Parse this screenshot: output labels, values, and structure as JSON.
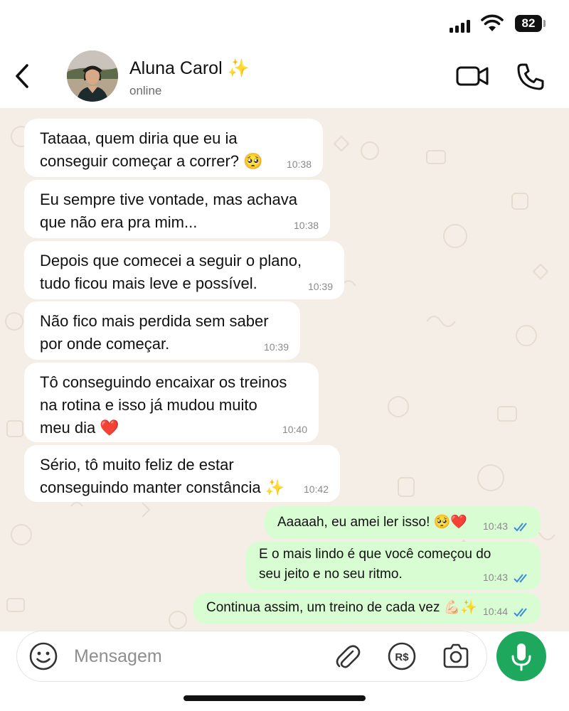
{
  "status_bar": {
    "battery": "82"
  },
  "header": {
    "name": "Aluna Carol ✨",
    "status": "online"
  },
  "messages": [
    {
      "direction": "in",
      "text": "Tataaa, quem diria que eu ia\nconseguir começar a correr? 🥺",
      "time": "10:38"
    },
    {
      "direction": "in",
      "text": "Eu sempre tive vontade, mas achava\nque não era pra mim...",
      "time": "10:38"
    },
    {
      "direction": "in",
      "text": "Depois que comecei a seguir o plano,\ntudo ficou mais leve e possível.",
      "time": "10:39"
    },
    {
      "direction": "in",
      "text": "Não fico mais perdida sem saber\npor onde começar.",
      "time": "10:39"
    },
    {
      "direction": "in",
      "text": "Tô conseguindo encaixar os treinos\nna rotina e isso já mudou muito\nmeu dia ❤️",
      "time": "10:40"
    },
    {
      "direction": "in",
      "text": "Sério, tô muito feliz de estar\nconseguindo manter constância ✨",
      "time": "10:42"
    },
    {
      "direction": "out",
      "text": "Aaaaah, eu amei ler isso! 🥺❤️",
      "time": "10:43"
    },
    {
      "direction": "out",
      "text": "E o mais lindo é que você começou do\nseu jeito e no seu ritmo.",
      "time": "10:43"
    },
    {
      "direction": "out",
      "text": "Continua assim, um treino de cada vez 💪🏻✨",
      "time": "10:44"
    }
  ],
  "composer": {
    "placeholder": "Mensagem"
  },
  "colors": {
    "chat_background": "#f4eee6",
    "incoming_bubble": "#ffffff",
    "outgoing_bubble": "#d9fdd3",
    "read_ticks": "#3d8bd8",
    "mic_button": "#1da85d"
  },
  "icons": [
    "back-arrow-icon",
    "video-call-icon",
    "phone-icon",
    "emoji-icon",
    "paperclip-icon",
    "payment-icon",
    "camera-icon",
    "microphone-icon",
    "double-check-icon"
  ]
}
